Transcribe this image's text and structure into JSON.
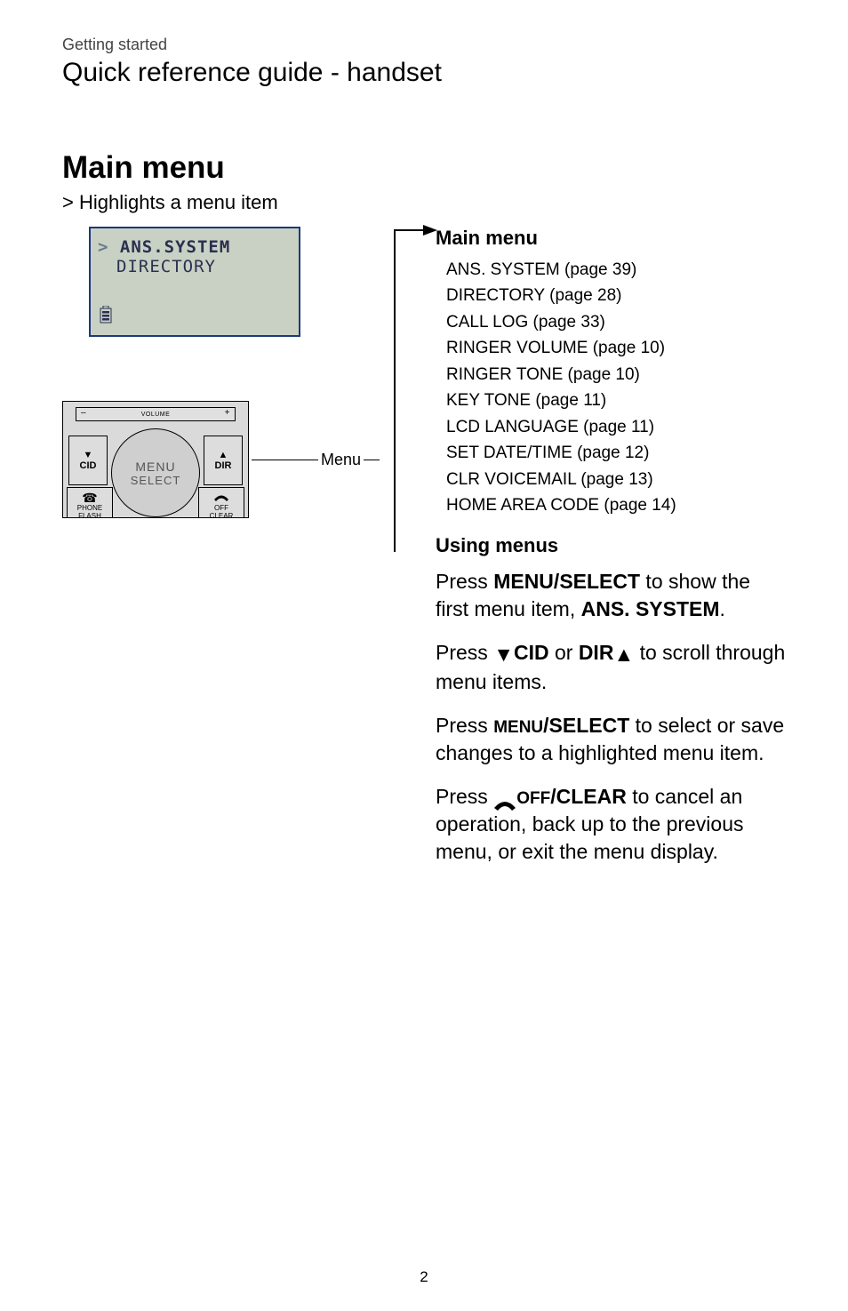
{
  "breadcrumb": "Getting started",
  "page_title": "Quick reference guide - handset",
  "left": {
    "heading": "Main menu",
    "note": "> Highlights a menu item",
    "lcd": {
      "line1": "ANS.SYSTEM",
      "line2": "DIRECTORY",
      "battery_icon": "battery-icon"
    },
    "handset": {
      "volume_label": "VOLUME",
      "cid": "CID",
      "dir": "DIR",
      "menu": "MENU",
      "select": "SELECT",
      "phone": "PHONE",
      "flash": "FLASH",
      "off": "OFF",
      "clear": "CLEAR"
    },
    "callout_label": "Menu"
  },
  "right": {
    "menu_title": "Main menu",
    "items": [
      "ANS. SYSTEM (page 39)",
      "DIRECTORY (page 28)",
      "CALL LOG (page 33)",
      "RINGER VOLUME (page 10)",
      "RINGER TONE (page 10)",
      "KEY TONE (page 11)",
      "LCD LANGUAGE (page 11)",
      "SET DATE/TIME (page 12)",
      "CLR VOICEMAIL (page 13)",
      "HOME AREA CODE (page 14)"
    ],
    "using_title": "Using menus",
    "p1_a": "Press ",
    "p1_b": "MENU/",
    "p1_c": "SELECT",
    "p1_d": " to show the first menu item, ",
    "p1_e": "ANS. SYSTEM",
    "p1_f": ".",
    "p2_a": "Press ",
    "p2_cid": "CID",
    "p2_or": " or ",
    "p2_dir": "DIR",
    "p2_d": " to scroll through menu items.",
    "p3_a": "Press ",
    "p3_b": "MENU",
    "p3_bs": "/",
    "p3_c": "SELECT",
    "p3_d": " to select or save changes to a highlighted menu item.",
    "p4_a": "Press ",
    "p4_off": "OFF",
    "p4_sl": "/",
    "p4_clear": "CLEAR",
    "p4_d": " to cancel an operation, back up to the previous menu, or exit the menu display."
  },
  "page_number": "2"
}
